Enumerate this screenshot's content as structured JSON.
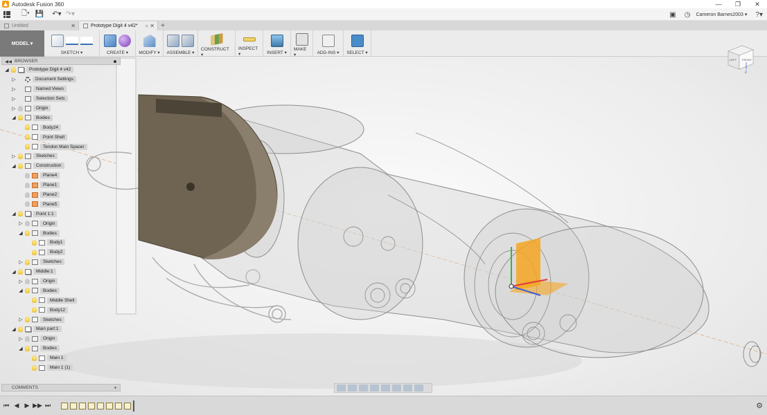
{
  "window": {
    "title": "Autodesk Fusion 360",
    "minimize": "—",
    "maximize": "❐",
    "close": "✕"
  },
  "quickaccess": {
    "user": "Cameron Barnes2003 ▾",
    "help": "?▾"
  },
  "tabs": [
    {
      "label": "Untitled",
      "close": "✕"
    },
    {
      "label": "Prototype Digit 4 v42*",
      "close": "○ ✕"
    }
  ],
  "ribbon": {
    "workspace": "MODEL ▾",
    "groups": [
      {
        "label": "SKETCH ▾"
      },
      {
        "label": "CREATE ▾"
      },
      {
        "label": "MODIFY ▾"
      },
      {
        "label": "ASSEMBLE ▾"
      },
      {
        "label": "CONSTRUCT ▾"
      },
      {
        "label": "INSPECT ▾"
      },
      {
        "label": "INSERT ▾"
      },
      {
        "label": "MAKE ▾"
      },
      {
        "label": "ADD-INS ▾"
      },
      {
        "label": "SELECT ▾"
      }
    ]
  },
  "browser": {
    "title": "BROWSER",
    "nodes": [
      {
        "label": "Prototype Digit 4 v42",
        "tri": "◢",
        "depth": 0,
        "icon": "comp",
        "bulb": true
      },
      {
        "label": "Document Settings",
        "tri": "▷",
        "depth": 1,
        "icon": "gear",
        "bulb": false
      },
      {
        "label": "Named Views",
        "tri": "▷",
        "depth": 1,
        "icon": "folder",
        "bulb": false
      },
      {
        "label": "Selection Sets",
        "tri": "▷",
        "depth": 1,
        "icon": "folder",
        "bulb": false
      },
      {
        "label": "Origin",
        "tri": "▷",
        "depth": 1,
        "icon": "folder",
        "bulb": true,
        "bulbOff": true
      },
      {
        "label": "Bodies",
        "tri": "◢",
        "depth": 1,
        "icon": "folder",
        "bulb": true
      },
      {
        "label": "Body24",
        "tri": "",
        "depth": 2,
        "icon": "body",
        "bulb": true
      },
      {
        "label": "Point Shell",
        "tri": "",
        "depth": 2,
        "icon": "body",
        "bulb": true
      },
      {
        "label": "Tendon Main Spacer",
        "tri": "",
        "depth": 2,
        "icon": "body",
        "bulb": true
      },
      {
        "label": "Sketches",
        "tri": "▷",
        "depth": 1,
        "icon": "folder",
        "bulb": true
      },
      {
        "label": "Construction",
        "tri": "◢",
        "depth": 1,
        "icon": "folder",
        "bulb": true
      },
      {
        "label": "Plane4",
        "tri": "",
        "depth": 2,
        "icon": "plane",
        "bulb": true,
        "bulbOff": true
      },
      {
        "label": "Plane1",
        "tri": "",
        "depth": 2,
        "icon": "plane",
        "bulb": true,
        "bulbOff": true
      },
      {
        "label": "Plane2",
        "tri": "",
        "depth": 2,
        "icon": "plane",
        "bulb": true,
        "bulbOff": true
      },
      {
        "label": "Plane5",
        "tri": "",
        "depth": 2,
        "icon": "plane",
        "bulb": true,
        "bulbOff": true
      },
      {
        "label": "Point 1:1",
        "tri": "◢",
        "depth": 1,
        "icon": "comp",
        "bulb": true
      },
      {
        "label": "Origin",
        "tri": "▷",
        "depth": 2,
        "icon": "folder",
        "bulb": true,
        "bulbOff": true
      },
      {
        "label": "Bodies",
        "tri": "◢",
        "depth": 2,
        "icon": "folder",
        "bulb": true
      },
      {
        "label": "Body1",
        "tri": "",
        "depth": 3,
        "icon": "body",
        "bulb": true
      },
      {
        "label": "Body2",
        "tri": "",
        "depth": 3,
        "icon": "body",
        "bulb": true
      },
      {
        "label": "Sketches",
        "tri": "▷",
        "depth": 2,
        "icon": "folder",
        "bulb": true
      },
      {
        "label": "Middle:1",
        "tri": "◢",
        "depth": 1,
        "icon": "comp",
        "bulb": true
      },
      {
        "label": "Origin",
        "tri": "▷",
        "depth": 2,
        "icon": "folder",
        "bulb": true,
        "bulbOff": true
      },
      {
        "label": "Bodies",
        "tri": "◢",
        "depth": 2,
        "icon": "folder",
        "bulb": true
      },
      {
        "label": "Middle Shell",
        "tri": "",
        "depth": 3,
        "icon": "body",
        "bulb": true
      },
      {
        "label": "Body12",
        "tri": "",
        "depth": 3,
        "icon": "body",
        "bulb": true
      },
      {
        "label": "Sketches",
        "tri": "▷",
        "depth": 2,
        "icon": "folder",
        "bulb": true
      },
      {
        "label": "Main part:1",
        "tri": "◢",
        "depth": 1,
        "icon": "comp",
        "bulb": true
      },
      {
        "label": "Origin",
        "tri": "▷",
        "depth": 2,
        "icon": "folder",
        "bulb": true,
        "bulbOff": true
      },
      {
        "label": "Bodies",
        "tri": "◢",
        "depth": 2,
        "icon": "folder",
        "bulb": true
      },
      {
        "label": "Main 1",
        "tri": "",
        "depth": 3,
        "icon": "body",
        "bulb": true
      },
      {
        "label": "Main 1 (1)",
        "tri": "",
        "depth": 3,
        "icon": "body",
        "bulb": true
      }
    ]
  },
  "comments": {
    "title": "COMMENTS",
    "plus": "+"
  },
  "viewcube": {
    "left": "LEFT",
    "front": "FRONT",
    "axis": "Z"
  },
  "timeline": {
    "buttons": [
      "⏮",
      "◀",
      "▶",
      "▶▶",
      "⏭"
    ],
    "settings": "⚙"
  },
  "colors": {
    "tan_face": "#6f6452",
    "ghost": "#9a9a9a",
    "accent_orange": "#f5a623",
    "select_blue": "#4a8bc9"
  }
}
